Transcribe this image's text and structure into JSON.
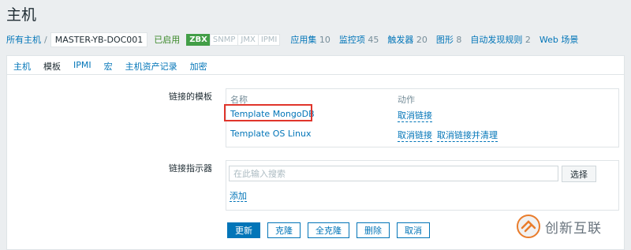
{
  "page": {
    "title": "主机"
  },
  "nav": {
    "breadcrumb_root": "所有主机",
    "separator": "/",
    "host_name": "MASTER-YB-DOC001",
    "status": "已启用",
    "badges": [
      {
        "label": "ZBX",
        "active": true
      },
      {
        "label": "SNMP",
        "active": false
      },
      {
        "label": "JMX",
        "active": false
      },
      {
        "label": "IPMI",
        "active": false
      }
    ],
    "links": [
      {
        "label": "应用集",
        "count": "10"
      },
      {
        "label": "监控项",
        "count": "45"
      },
      {
        "label": "触发器",
        "count": "20"
      },
      {
        "label": "图形",
        "count": "8"
      },
      {
        "label": "自动发现规则",
        "count": "2"
      },
      {
        "label": "Web 场景",
        "count": ""
      }
    ]
  },
  "tabs": [
    {
      "label": "主机",
      "active": false
    },
    {
      "label": "模板",
      "active": true
    },
    {
      "label": "IPMI",
      "active": false
    },
    {
      "label": "宏",
      "active": false
    },
    {
      "label": "主机资产记录",
      "active": false
    },
    {
      "label": "加密",
      "active": false
    }
  ],
  "linked_templates": {
    "label": "链接的模板",
    "col_name": "名称",
    "col_action": "动作",
    "rows": [
      {
        "name": "Template MongoDB",
        "actions": [
          "取消链接"
        ]
      },
      {
        "name": "Template OS Linux",
        "actions": [
          "取消链接",
          "取消链接并清理"
        ]
      }
    ]
  },
  "link_new": {
    "label": "链接指示器",
    "search_placeholder": "在此输入搜索",
    "select_label": "选择",
    "add_label": "添加"
  },
  "buttons": {
    "update": "更新",
    "clone": "克隆",
    "full_clone": "全克隆",
    "delete": "删除",
    "cancel": "取消"
  },
  "watermark": {
    "text": "创新互联"
  },
  "colors": {
    "accent": "#0275b8",
    "enabled": "#3d8a2b",
    "zbx_badge": "#429e47",
    "highlight": "#e0352b"
  }
}
